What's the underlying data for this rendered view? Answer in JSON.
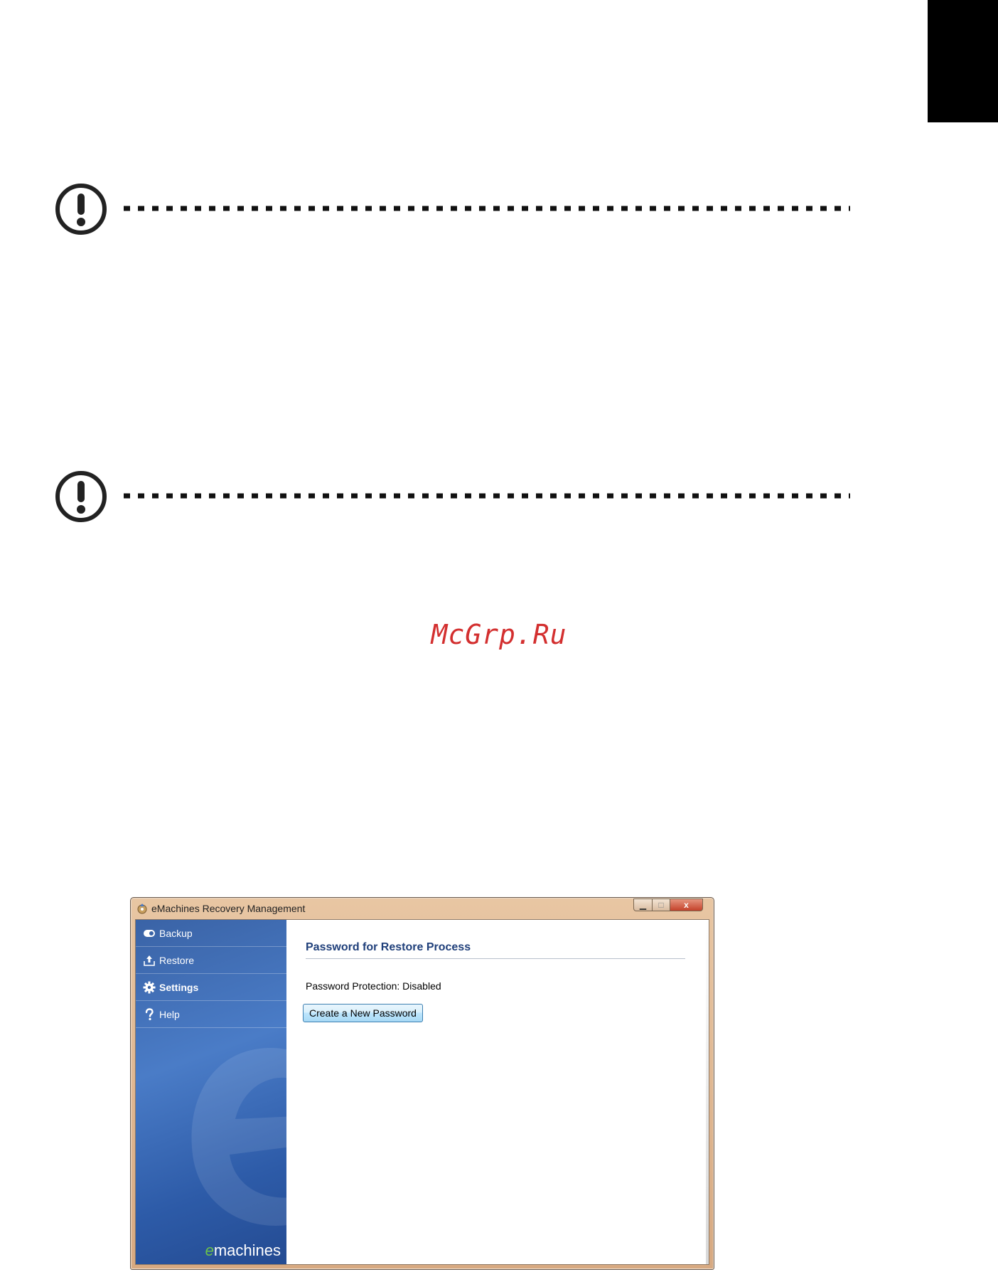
{
  "watermark": "McGrp.Ru",
  "window": {
    "title": "eMachines Recovery Management",
    "controls": {
      "minimize": "▁",
      "maximize": "□",
      "close": "x"
    }
  },
  "sidebar": {
    "items": [
      {
        "label": "Backup",
        "icon": "backup-icon",
        "active": false
      },
      {
        "label": "Restore",
        "icon": "restore-icon",
        "active": false
      },
      {
        "label": "Settings",
        "icon": "gear-icon",
        "active": true
      },
      {
        "label": "Help",
        "icon": "question-icon",
        "active": false
      }
    ],
    "brand_prefix": "e",
    "brand_suffix": "machines"
  },
  "content": {
    "title": "Password for Restore Process",
    "status": "Password Protection: Disabled",
    "create_button_label": "Create a New Password"
  },
  "colors": {
    "sidebar_blue": "#3a63a6",
    "title_blue": "#1f3f7a",
    "brand_green": "#6cc24a",
    "titlebar_tan": "#e8c6a3",
    "watermark_red": "#d32f2f"
  }
}
